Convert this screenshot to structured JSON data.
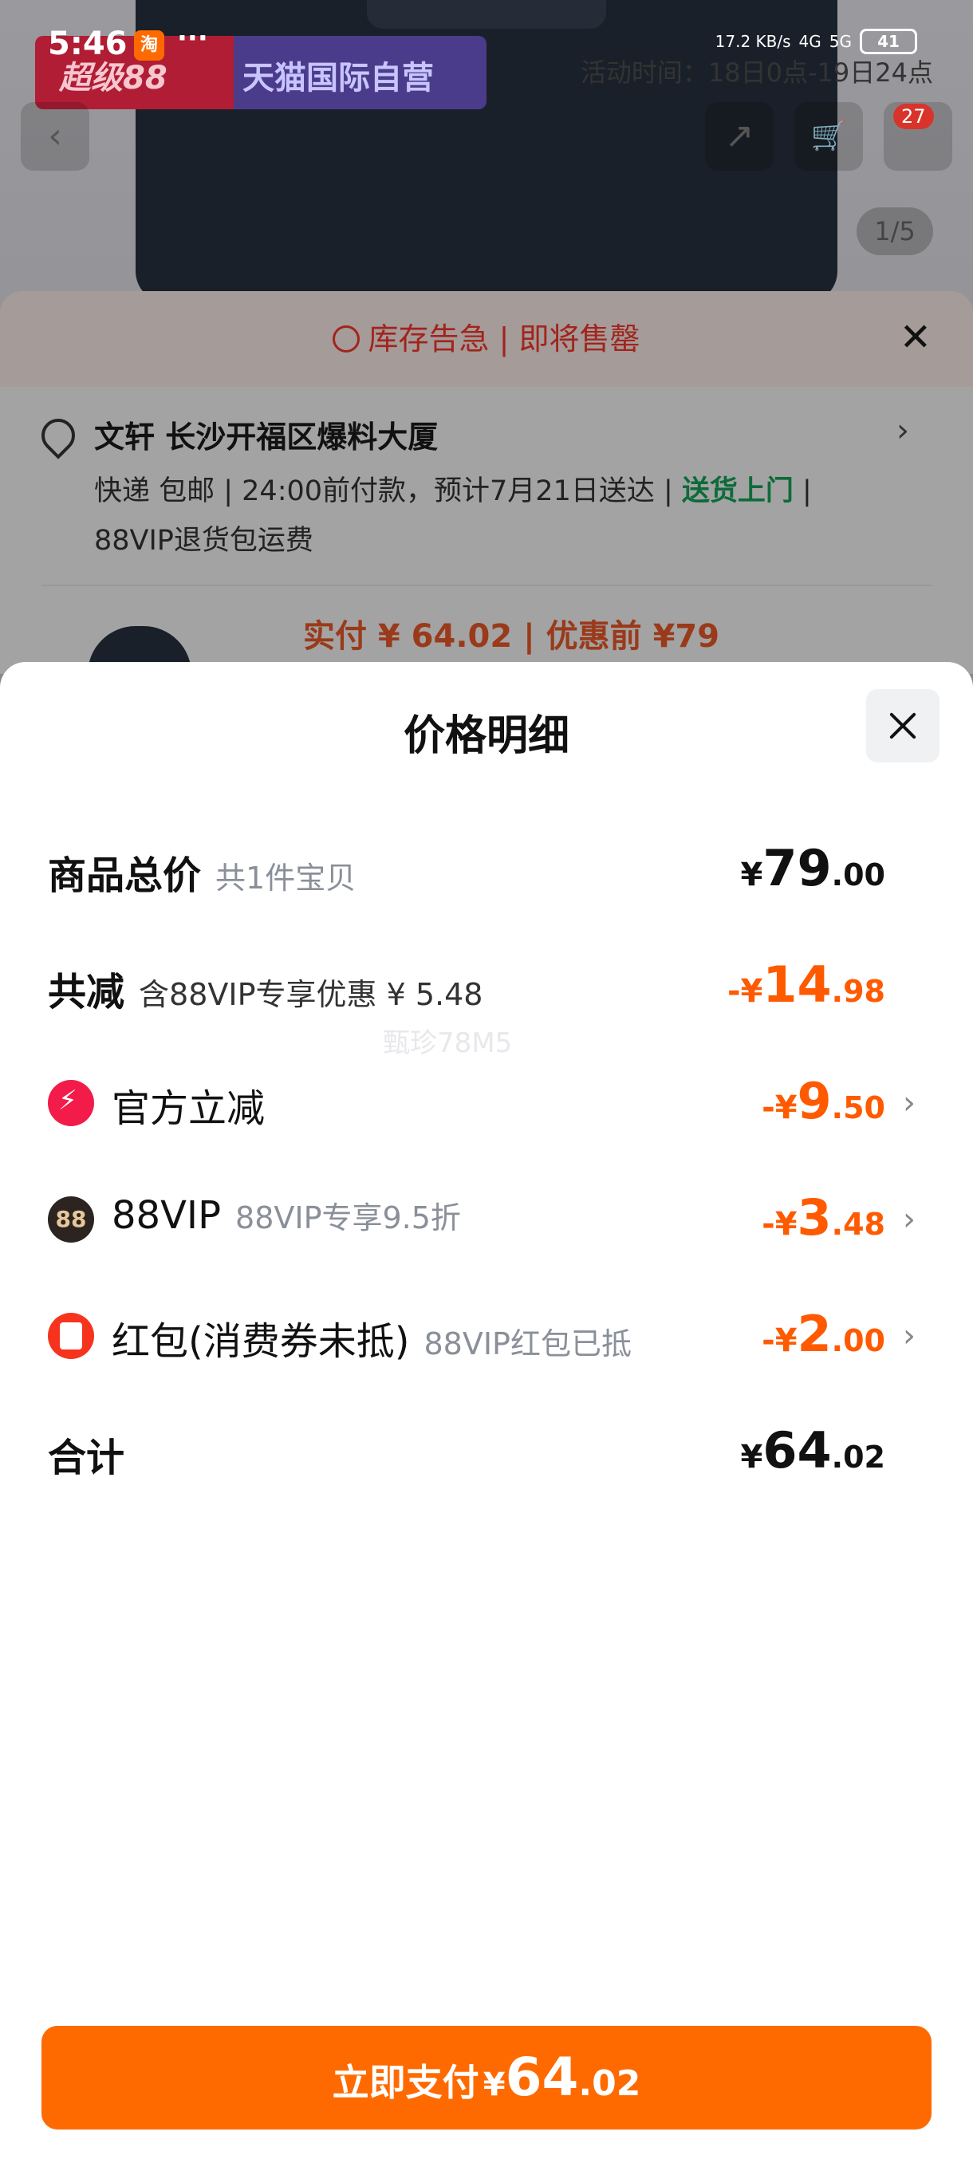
{
  "status_bar": {
    "time": "5:46",
    "app_badge": "淘",
    "more": "···",
    "speed": "17.2 KB/s",
    "network_4g": "4G",
    "network_5g": "5G",
    "battery": "41"
  },
  "background": {
    "banner_left": "超级88",
    "banner_right": "天猫国际自营",
    "activity_time": "活动时间：18日0点-19日24点",
    "cart_badge": "27",
    "page_indicator": "1/5",
    "back_icon": "‹",
    "share_icon": "↗",
    "cart_icon": "🛒"
  },
  "order_sheet": {
    "stock_alert_a": "库存告急",
    "stock_alert_sep": "|",
    "stock_alert_b": "即将售罄",
    "close": "✕",
    "address": "文轩 长沙开福区爆料大厦",
    "delivery_text": "快递 包邮 | 24:00前付款，预计7月21日送达 | ",
    "delivery_green": "送货上门",
    "delivery_tail": " |",
    "vip_return": "88VIP退货包运费",
    "price_preview": "实付 ¥ 64.02 | 优惠前 ¥79"
  },
  "price_detail": {
    "title": "价格明细",
    "watermark": "甄珍78M5",
    "rows": [
      {
        "label": "商品总价",
        "sub": "共1件宝贝",
        "cur": "¥",
        "int": "79",
        "dec": ".00"
      },
      {
        "label": "共减",
        "sub": "含88VIP专享优惠 ¥ 5.48",
        "cur": "-¥",
        "int": "14",
        "dec": ".98"
      },
      {
        "label": "官方立减",
        "sub": "",
        "cur": "-¥",
        "int": "9",
        "dec": ".50"
      },
      {
        "label": "88VIP",
        "sub": "88VIP专享9.5折",
        "cur": "-¥",
        "int": "3",
        "dec": ".48",
        "icon_text": "88"
      },
      {
        "label": "红包(消费券未抵)",
        "sub": "88VIP红包已抵",
        "cur": "-¥",
        "int": "2",
        "dec": ".00"
      },
      {
        "label": "合计",
        "sub": "",
        "cur": "¥",
        "int": "64",
        "dec": ".02"
      }
    ],
    "chevron": "›",
    "pay_button": {
      "text": "立即支付",
      "cur": "¥",
      "int": "64",
      "dec": ".02"
    }
  },
  "colors": {
    "accent": "#ff6a00",
    "discount": "#ff5a00",
    "alert": "#a2241c",
    "delivery_green": "#0d6b3a"
  }
}
